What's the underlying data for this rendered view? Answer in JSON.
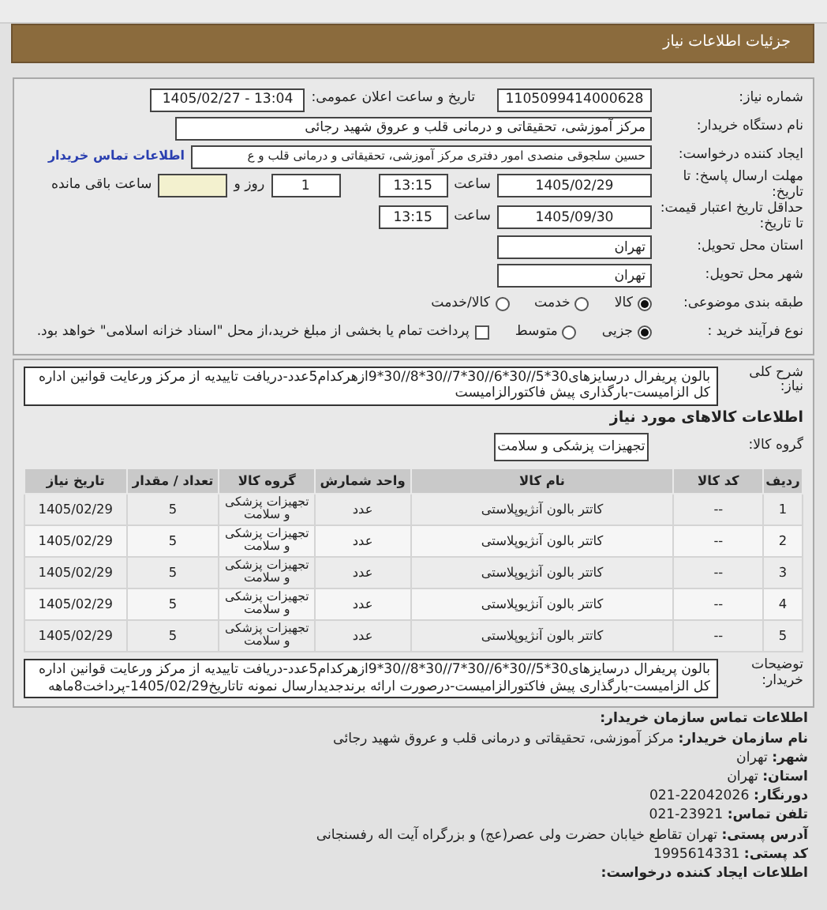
{
  "header": {
    "title": "جزئیات اطلاعات نیاز"
  },
  "need": {
    "number_label": "شماره نیاز:",
    "number": "1105099414000628",
    "announce_label": "تاریخ و ساعت اعلان عمومی:",
    "announce": "1405/02/27 - 13:04"
  },
  "buyer": {
    "label": "نام دستگاه خریدار:",
    "value": "مرکز آموزشی، تحقیقاتی و درمانی قلب و عروق شهید رجائی"
  },
  "creator": {
    "label": "ایجاد کننده درخواست:",
    "value": "حسین سلجوقی منصدی امور دفتری مرکز آموزشی، تحقیقاتی و درمانی قلب و ع",
    "link": "اطلاعات تماس خریدار"
  },
  "deadline": {
    "label": "مهلت ارسال پاسخ: تا تاریخ:",
    "date": "1405/02/29",
    "time_label": "ساعت",
    "time": "13:15",
    "days": "1",
    "days_label": "روز و",
    "remaining_label": "ساعت باقی مانده"
  },
  "validity": {
    "label": "حداقل تاریخ اعتبار قیمت: تا تاریخ:",
    "date": "1405/09/30",
    "time_label": "ساعت",
    "time": "13:15"
  },
  "province": {
    "label": "استان محل تحویل:",
    "value": "تهران"
  },
  "city": {
    "label": "شهر محل تحویل:",
    "value": "تهران"
  },
  "category": {
    "label": "طبقه بندی موضوعی:",
    "options": [
      {
        "label": "کالا",
        "selected": true
      },
      {
        "label": "خدمت",
        "selected": false
      },
      {
        "label": "کالا/خدمت",
        "selected": false
      }
    ]
  },
  "process": {
    "label": "نوع فرآیند خرید :",
    "options": [
      {
        "label": "جزیی",
        "selected": true
      },
      {
        "label": "متوسط",
        "selected": false
      }
    ],
    "treasury": {
      "label": "پرداخت تمام یا بخشی از مبلغ خرید،از محل \"اسناد خزانه اسلامی\" خواهد بود.",
      "checked": false
    }
  },
  "description": {
    "label": "شرح کلی نیاز:",
    "text": "بالون پریفرال درسایزهای30*5//30*6//30*7//30*8//30*9ازهرکدام5عدد-دریافت تاییدیه از مرکز ورعایت قوانین اداره کل الزامیست-بارگذاری پیش فاکتورالزامیست"
  },
  "goods": {
    "heading": "اطلاعات کالاهای مورد نیاز",
    "group_label": "گروه کالا:",
    "group": "تجهیزات پزشکی و سلامت",
    "table": {
      "columns": [
        "ردیف",
        "کد کالا",
        "نام کالا",
        "واحد شمارش",
        "گروه کالا",
        "تعداد / مقدار",
        "تاریخ نیاز"
      ],
      "rows": [
        [
          "1",
          "--",
          "کاتتر بالون آنژیوپلاستی",
          "عدد",
          "تجهیزات پزشکی و سلامت",
          "5",
          "1405/02/29"
        ],
        [
          "2",
          "--",
          "کاتتر بالون آنژیوپلاستی",
          "عدد",
          "تجهیزات پزشکی و سلامت",
          "5",
          "1405/02/29"
        ],
        [
          "3",
          "--",
          "کاتتر بالون آنژیوپلاستی",
          "عدد",
          "تجهیزات پزشکی و سلامت",
          "5",
          "1405/02/29"
        ],
        [
          "4",
          "--",
          "کاتتر بالون آنژیوپلاستی",
          "عدد",
          "تجهیزات پزشکی و سلامت",
          "5",
          "1405/02/29"
        ],
        [
          "5",
          "--",
          "کاتتر بالون آنژیوپلاستی",
          "عدد",
          "تجهیزات پزشکی و سلامت",
          "5",
          "1405/02/29"
        ]
      ]
    }
  },
  "buyer_notes": {
    "label": "توضیحات خریدار:",
    "text": "بالون پریفرال درسایزهای30*5//30*6//30*7//30*8//30*9ازهرکدام5عدد-دریافت تاییدیه از مرکز ورعایت قوانین اداره کل الزامیست-بارگذاری پیش فاکتورالزامیست-درصورت ارائه برندجدیدارسال نمونه تاتاریخ1405/02/29-پرداخت8ماهه"
  },
  "contact": {
    "heading": "اطلاعات تماس سازمان خریدار:",
    "lines": [
      {
        "label": "نام سازمان خریدار:",
        "value": "مرکز آموزشی، تحقیقاتی و درمانی قلب و عروق شهید رجائی"
      },
      {
        "label": "شهر:",
        "value": "تهران"
      },
      {
        "label": "استان:",
        "value": "تهران"
      },
      {
        "label": "دورنگار:",
        "value": "22042026-021"
      },
      {
        "label": "تلفن تماس:",
        "value": "23921-021"
      },
      {
        "label": "آدرس پستی:",
        "value": "تهران تقاطع خیابان حضرت ولی عصر(عج) و بزرگراه آیت اله رفسنجانی"
      },
      {
        "label": "کد پستی:",
        "value": "1995614331"
      }
    ],
    "footer_heading": "اطلاعات ایجاد کننده درخواست:"
  }
}
